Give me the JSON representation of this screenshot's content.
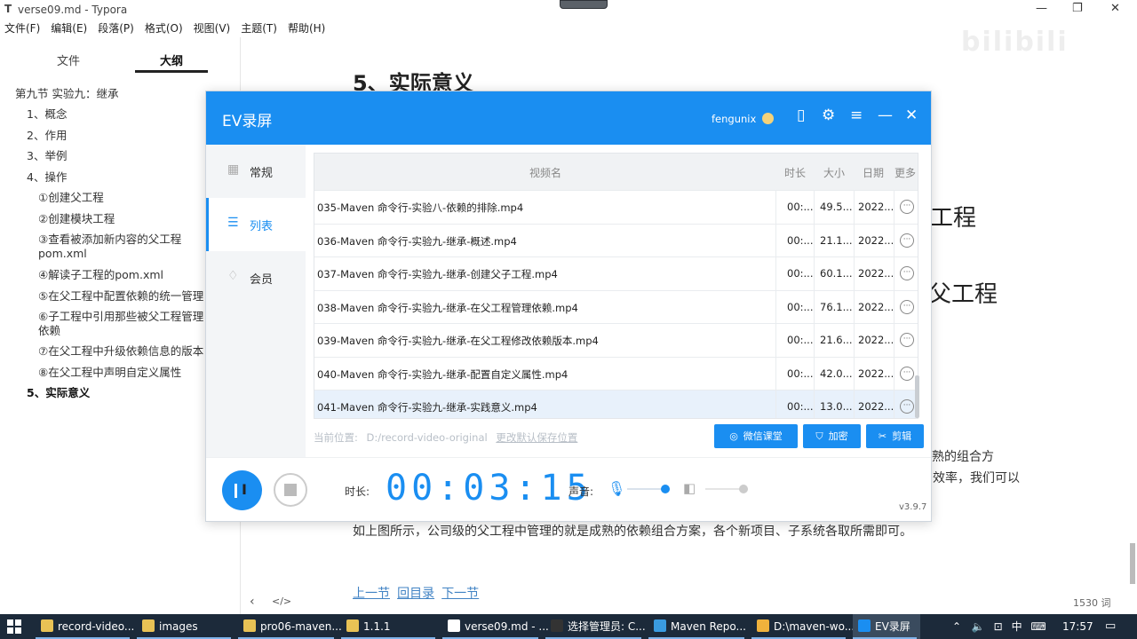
{
  "typora": {
    "window_title": "verse09.md - Typora",
    "app_icon": "T",
    "menu": [
      "文件(F)",
      "编辑(E)",
      "段落(P)",
      "格式(O)",
      "视图(V)",
      "主题(T)",
      "帮助(H)"
    ],
    "sidebar_tabs": [
      "文件",
      "大纲"
    ],
    "outline": [
      "第九节 实验九：继承",
      "1、概念",
      "2、作用",
      "3、举例",
      "4、操作",
      "①创建父工程",
      "②创建模块工程",
      "③查看被添加新内容的父工程",
      "pom.xml",
      "④解读子工程的pom.xml",
      "⑤在父工程中配置依赖的统一管理",
      "⑥子工程中引用那些被父工程管理",
      "依赖",
      "⑦在父工程中升级依赖信息的版本",
      "⑧在父工程中声明自定义属性",
      "5、实际意义"
    ],
    "bottom_icons": [
      "‹",
      "</>"
    ],
    "heading": "5、实际意义",
    "bg_fragment_1": "工程",
    "bg_fragment_2": "父工程",
    "bg_fragment_3": "熟的组合方",
    "bg_fragment_4": "效率，我们可以",
    "paragraph": "如上图所示，公司级的父工程中管理的就是成熟的依赖组合方案，各个新项目、子系统各取所需即可。",
    "links": [
      "上一节",
      "回目录",
      "下一节"
    ],
    "word_count": "1530 词",
    "watermark": "bilibili"
  },
  "ev": {
    "title": "EV录屏",
    "user": "fengunix",
    "header_icons": [
      "phone-icon",
      "settings-icon",
      "menu-icon",
      "minimize-icon",
      "close-icon"
    ],
    "nav": [
      {
        "label": "常规",
        "icon": "grid-icon"
      },
      {
        "label": "列表",
        "icon": "list-icon"
      },
      {
        "label": "会员",
        "icon": "vip-icon"
      }
    ],
    "columns": [
      "视频名",
      "时长",
      "大小",
      "日期",
      "更多"
    ],
    "rows": [
      {
        "name": "035-Maven 命令行-实验八-依赖的排除.mp4",
        "duration": "00:...",
        "size": "49.5...",
        "date": "2022..."
      },
      {
        "name": "036-Maven 命令行-实验九-继承-概述.mp4",
        "duration": "00:...",
        "size": "21.1...",
        "date": "2022..."
      },
      {
        "name": "037-Maven 命令行-实验九-继承-创建父子工程.mp4",
        "duration": "00:...",
        "size": "60.1...",
        "date": "2022..."
      },
      {
        "name": "038-Maven 命令行-实验九-继承-在父工程管理依赖.mp4",
        "duration": "00:...",
        "size": "76.1...",
        "date": "2022..."
      },
      {
        "name": "039-Maven 命令行-实验九-继承-在父工程修改依赖版本.mp4",
        "duration": "00:...",
        "size": "21.6...",
        "date": "2022..."
      },
      {
        "name": "040-Maven 命令行-实验九-继承-配置自定义属性.mp4",
        "duration": "00:...",
        "size": "42.0...",
        "date": "2022..."
      },
      {
        "name": "041-Maven 命令行-实验九-继承-实践意义.mp4",
        "duration": "00:...",
        "size": "13.0...",
        "date": "2022..."
      }
    ],
    "path_label": "当前位置:",
    "path_value": "D:/record-video-original",
    "path_link": "更改默认保存位置",
    "buttons": [
      "微信课堂",
      "加密",
      "剪辑"
    ],
    "duration_label": "时长:",
    "duration_value": "00:03:15",
    "volume_label": "声音:",
    "mic_level": 0.9,
    "speaker_level": 0.9,
    "version": "v3.9.7"
  },
  "taskbar": {
    "items": [
      {
        "label": "record-video...",
        "color": "#e8c255"
      },
      {
        "label": "images",
        "color": "#e8c255"
      },
      {
        "label": "pro06-maven...",
        "color": "#e8c255"
      },
      {
        "label": "1.1.1",
        "color": "#e8c255"
      },
      {
        "label": "verse09.md - ...",
        "color": "#ffffff"
      },
      {
        "label": "选择管理员: C...",
        "color": "#333333"
      },
      {
        "label": "Maven Repo...",
        "color": "#3a9be0"
      },
      {
        "label": "D:\\maven-wo...",
        "color": "#f0b23c"
      },
      {
        "label": "EV录屏",
        "color": "#1a8ef1"
      }
    ],
    "ime": "中",
    "time": "17:57"
  }
}
